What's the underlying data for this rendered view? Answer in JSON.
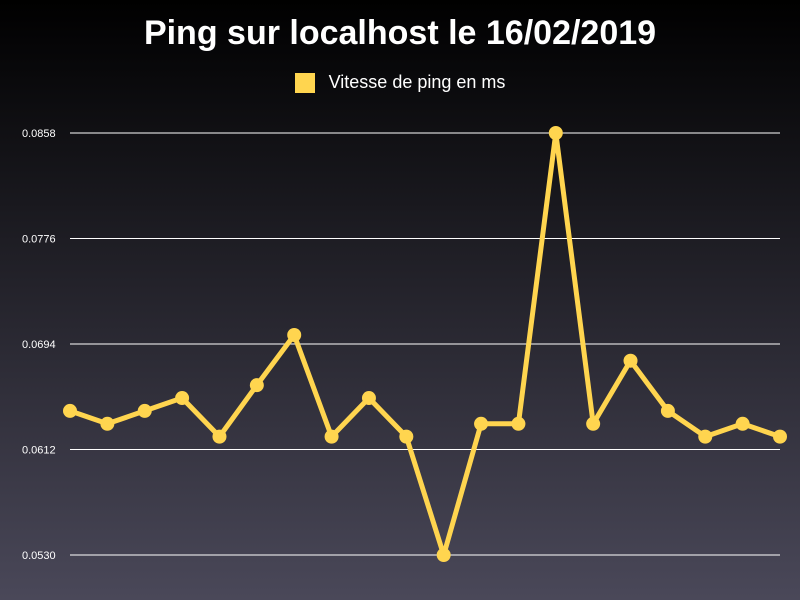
{
  "chart_data": {
    "type": "line",
    "title": "Ping sur localhost le 16/02/2019",
    "xlabel": "",
    "ylabel": "",
    "ylim": [
      0.053,
      0.0858
    ],
    "yticks": [
      "0.0530",
      "0.0612",
      "0.0694",
      "0.0776",
      "0.0858"
    ],
    "series": [
      {
        "name": "Vitesse de ping en ms",
        "color": "#ffd54f",
        "values": [
          0.0642,
          0.0632,
          0.0642,
          0.0652,
          0.0622,
          0.0662,
          0.0701,
          0.0622,
          0.0652,
          0.0622,
          0.053,
          0.0632,
          0.0632,
          0.0858,
          0.0632,
          0.0681,
          0.0642,
          0.0622,
          0.0632,
          0.0622
        ]
      }
    ],
    "grid": true,
    "legend": "top-center"
  },
  "colors": {
    "line": "#ffd54f",
    "grid": "#ffffff",
    "text": "#ffffff"
  }
}
